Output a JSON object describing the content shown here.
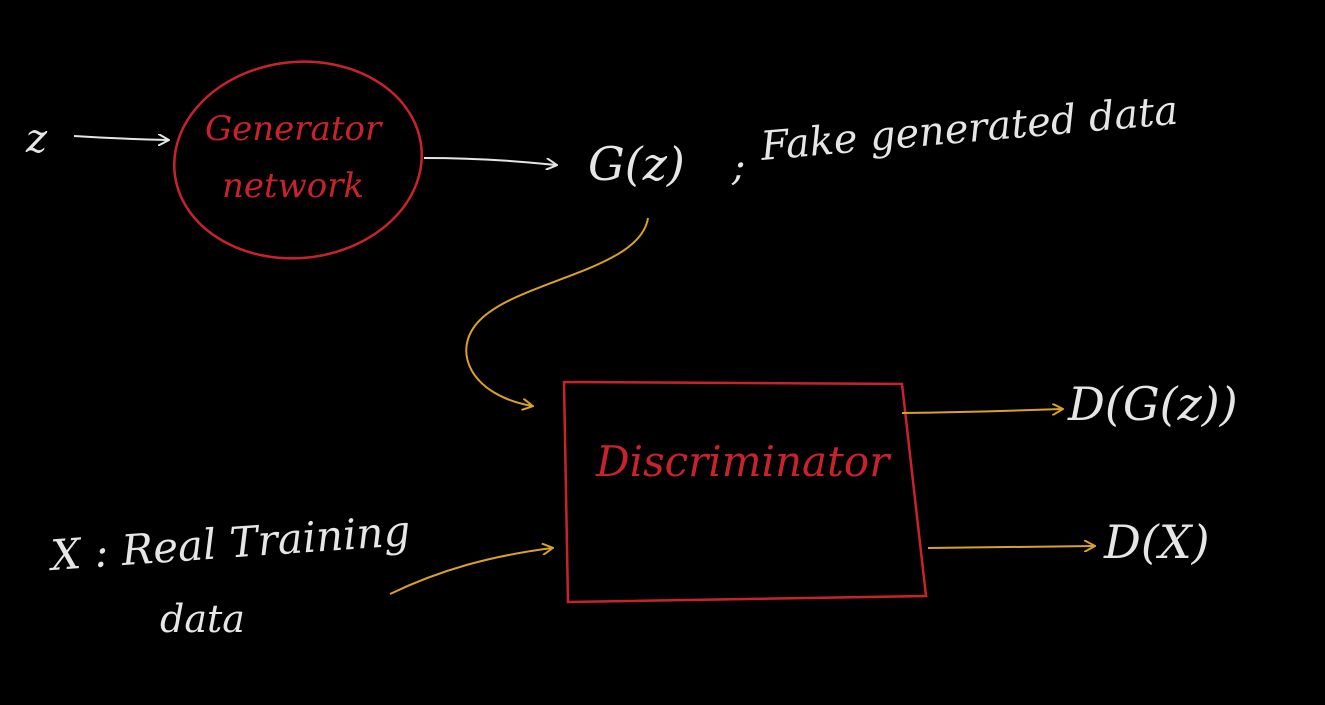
{
  "colors": {
    "background": "#000000",
    "ink_white": "#e6e6e6",
    "ink_red": "#c8232c",
    "ink_orange": "#d9a02a"
  },
  "nodes": {
    "z_input": "z",
    "generator": {
      "line1": "Generator",
      "line2": "network"
    },
    "generated": {
      "symbol": "G(z)",
      "separator": ";",
      "description": "Fake generated data"
    },
    "discriminator": "Discriminator",
    "real": {
      "line1": "X : Real Training",
      "line2": "data"
    },
    "output_fake": "D(G(z))",
    "output_real": "D(X)"
  }
}
